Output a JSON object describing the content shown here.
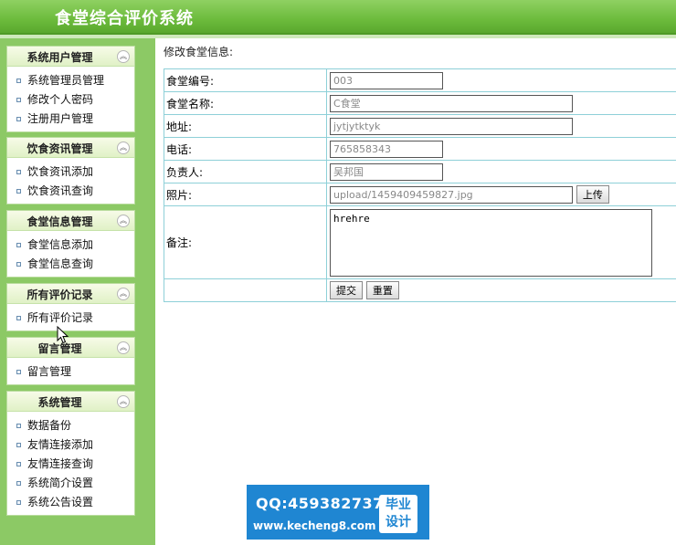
{
  "header": {
    "title": "食堂综合评价系统"
  },
  "sidebar": {
    "menus": [
      {
        "title": "系统用户管理",
        "items": [
          "系统管理员管理",
          "修改个人密码",
          "注册用户管理"
        ]
      },
      {
        "title": "饮食资讯管理",
        "items": [
          "饮食资讯添加",
          "饮食资讯查询"
        ]
      },
      {
        "title": "食堂信息管理",
        "items": [
          "食堂信息添加",
          "食堂信息查询"
        ]
      },
      {
        "title": "所有评价记录",
        "items": [
          "所有评价记录"
        ]
      },
      {
        "title": "留言管理",
        "items": [
          "留言管理"
        ]
      },
      {
        "title": "系统管理",
        "items": [
          "数据备份",
          "友情连接添加",
          "友情连接查询",
          "系统简介设置",
          "系统公告设置"
        ]
      }
    ],
    "toggle_icon": "double-chevron-up-icon"
  },
  "form": {
    "title": "修改食堂信息:",
    "fields": {
      "code": {
        "label": "食堂编号:",
        "value": "003"
      },
      "name": {
        "label": "食堂名称:",
        "value": "C食堂"
      },
      "address": {
        "label": "地址:",
        "value": "jytjytktyk"
      },
      "phone": {
        "label": "电话:",
        "value": "765858343"
      },
      "manager": {
        "label": "负责人:",
        "value": "吴邦国"
      },
      "photo": {
        "label": "照片:",
        "value": "upload/1459409459827.jpg",
        "upload_label": "上传"
      },
      "remark": {
        "label": "备注:",
        "value": "hrehre"
      }
    },
    "submit_label": "提交",
    "reset_label": "重置"
  },
  "watermark": {
    "qq": "QQ:459382737",
    "site": "www.kecheng8.com",
    "badge_line1": "毕业",
    "badge_line2": "设计"
  },
  "colors": {
    "header": "#6cbb3c",
    "sidebar": "#8cc965",
    "table_border": "#8ed0d8",
    "watermark": "#1f86d2"
  }
}
